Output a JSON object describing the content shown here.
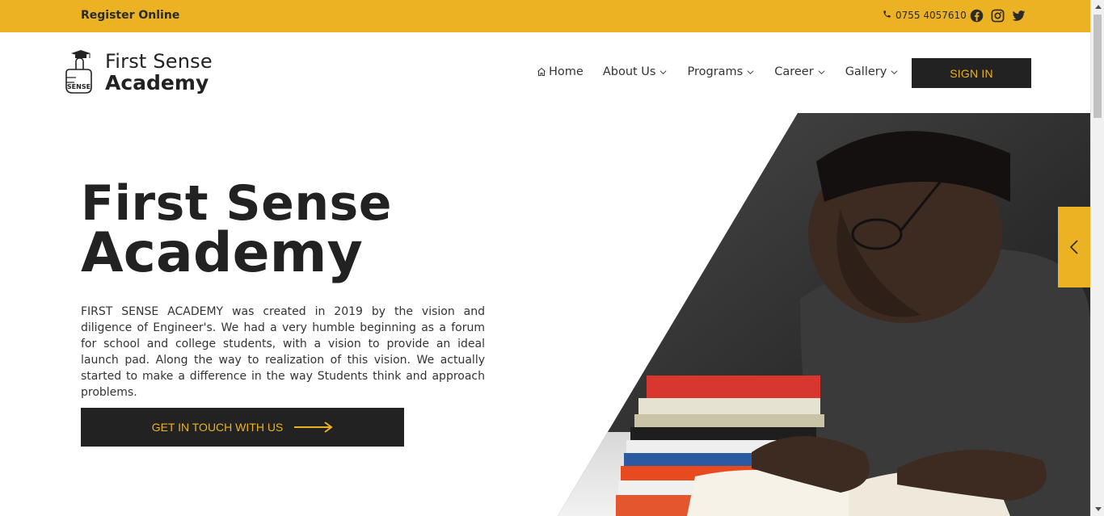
{
  "topbar": {
    "register_label": "Register Online",
    "phone": "0755 4057610",
    "social": [
      "facebook-icon",
      "instagram-icon",
      "twitter-icon"
    ],
    "bg_color": "#ebb223"
  },
  "brand": {
    "line1": "First Sense",
    "line2": "Academy",
    "logo_text": "SENSE"
  },
  "nav": {
    "items": [
      {
        "label": "Home",
        "icon": "home-icon",
        "dropdown": false
      },
      {
        "label": "About Us",
        "dropdown": true
      },
      {
        "label": "Programs",
        "dropdown": true
      },
      {
        "label": "Career",
        "dropdown": true
      },
      {
        "label": "Gallery",
        "dropdown": true
      }
    ],
    "signin_label": "SIGN IN"
  },
  "hero": {
    "title_line1": "First Sense",
    "title_line2": "Academy",
    "description": "FIRST SENSE ACADEMY was created in 2019 by the vision and diligence of Engineer's. We had a very humble beginning as a forum for school and college students, with a vision to provide an ideal launch pad. Along the way to realization of this vision. We actually started to make a difference in the way Students think and approach problems.",
    "cta_label": "GET IN TOUCH WITH US",
    "slider_prev_icon": "chevron-left-icon"
  },
  "colors": {
    "accent": "#ebb223",
    "dark": "#222222"
  }
}
